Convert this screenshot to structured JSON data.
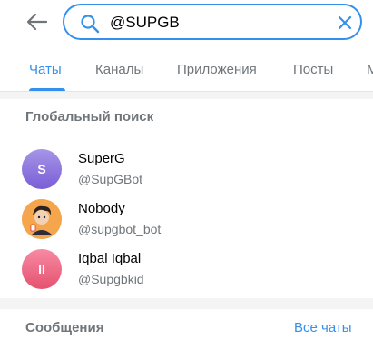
{
  "search": {
    "value": "@SUPGB"
  },
  "tabs": [
    {
      "label": "Чаты",
      "active": true
    },
    {
      "label": "Каналы"
    },
    {
      "label": "Приложения"
    },
    {
      "label": "Посты"
    },
    {
      "label": "М"
    }
  ],
  "global_search": {
    "title": "Глобальный поиск",
    "results": [
      {
        "title": "SuperG",
        "username": "@SupGBot",
        "avatar_letter": "S"
      },
      {
        "title": "Nobody",
        "username": "@supgbot_bot",
        "avatar_letter": ""
      },
      {
        "title": "Iqbal Iqbal",
        "username": "@Supgbkid",
        "avatar_letter": "II"
      }
    ]
  },
  "messages": {
    "title": "Сообщения",
    "all_chats_label": "Все чаты"
  },
  "colors": {
    "accent": "#3390ec",
    "secondary_text": "#707579",
    "section_bg": "#f4f4f5"
  }
}
